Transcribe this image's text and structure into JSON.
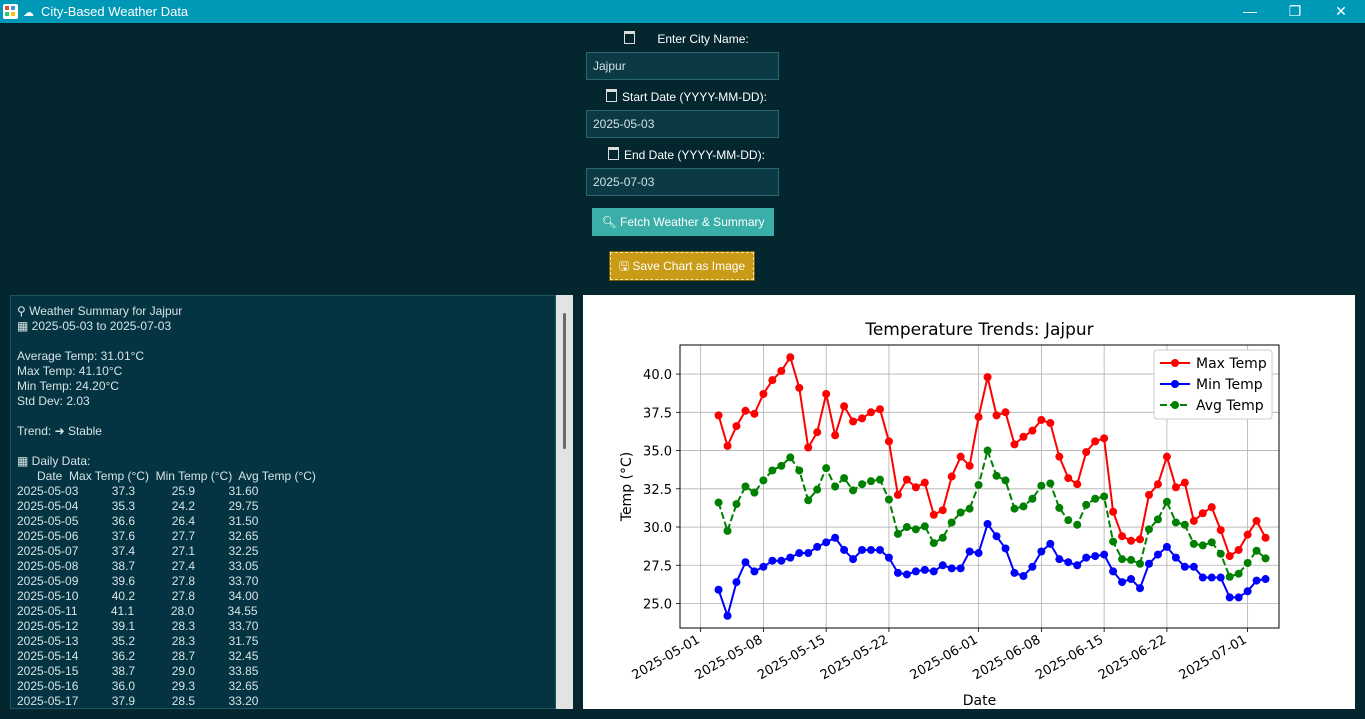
{
  "window": {
    "title": "City-Based Weather Data",
    "controls": {
      "minimize": "—",
      "restore": "❐",
      "close": "✕"
    }
  },
  "form": {
    "city_label": "Enter City Name:",
    "city_value": "Jajpur",
    "start_label": "Start Date (YYYY-MM-DD):",
    "start_value": "2025-05-03",
    "end_label": "End Date (YYYY-MM-DD):",
    "end_value": "2025-07-03",
    "fetch_button": "Fetch Weather & Summary",
    "save_button": "Save Chart as Image"
  },
  "summary": {
    "text": "⚲ Weather Summary for Jajpur\n▦ 2025-05-03 to 2025-07-03\n\nAverage Temp: 31.01°C\nMax Temp: 41.10°C\nMin Temp: 24.20°C\nStd Dev: 2.03\n\nTrend: ➜ Stable\n\n▦ Daily Data:\n      Date  Max Temp (°C)  Min Temp (°C)  Avg Temp (°C)\n2025-05-03          37.3           25.9          31.60\n2025-05-04          35.3           24.2          29.75\n2025-05-05          36.6           26.4          31.50\n2025-05-06          37.6           27.7          32.65\n2025-05-07          37.4           27.1          32.25\n2025-05-08          38.7           27.4          33.05\n2025-05-09          39.6           27.8          33.70\n2025-05-10          40.2           27.8          34.00\n2025-05-11          41.1           28.0          34.55\n2025-05-12          39.1           28.3          33.70\n2025-05-13          35.2           28.3          31.75\n2025-05-14          36.2           28.7          32.45\n2025-05-15          38.7           29.0          33.85\n2025-05-16          36.0           29.3          32.65\n2025-05-17          37.9           28.5          33.20"
  },
  "colors": {
    "max": "#ff0000",
    "min": "#0000ff",
    "avg": "#008000",
    "accent": "#0098b7"
  },
  "chart_data": {
    "type": "line",
    "title": "Temperature Trends: Jajpur",
    "xlabel": "Date",
    "ylabel": "Temp (°C)",
    "ylim": [
      23.4,
      41.9
    ],
    "yticks": [
      "25.0",
      "27.5",
      "30.0",
      "32.5",
      "35.0",
      "37.5",
      "40.0"
    ],
    "xticks": [
      "2025-05-01",
      "2025-05-08",
      "2025-05-15",
      "2025-05-22",
      "2025-06-01",
      "2025-06-08",
      "2025-06-15",
      "2025-06-22",
      "2025-07-01"
    ],
    "grid": true,
    "legend_position": "top-right",
    "x": [
      "2025-05-03",
      "2025-05-04",
      "2025-05-05",
      "2025-05-06",
      "2025-05-07",
      "2025-05-08",
      "2025-05-09",
      "2025-05-10",
      "2025-05-11",
      "2025-05-12",
      "2025-05-13",
      "2025-05-14",
      "2025-05-15",
      "2025-05-16",
      "2025-05-17",
      "2025-05-18",
      "2025-05-19",
      "2025-05-20",
      "2025-05-21",
      "2025-05-22",
      "2025-05-23",
      "2025-05-24",
      "2025-05-25",
      "2025-05-26",
      "2025-05-27",
      "2025-05-28",
      "2025-05-29",
      "2025-05-30",
      "2025-05-31",
      "2025-06-01",
      "2025-06-02",
      "2025-06-03",
      "2025-06-04",
      "2025-06-05",
      "2025-06-06",
      "2025-06-07",
      "2025-06-08",
      "2025-06-09",
      "2025-06-10",
      "2025-06-11",
      "2025-06-12",
      "2025-06-13",
      "2025-06-14",
      "2025-06-15",
      "2025-06-16",
      "2025-06-17",
      "2025-06-18",
      "2025-06-19",
      "2025-06-20",
      "2025-06-21",
      "2025-06-22",
      "2025-06-23",
      "2025-06-24",
      "2025-06-25",
      "2025-06-26",
      "2025-06-27",
      "2025-06-28",
      "2025-06-29",
      "2025-06-30",
      "2025-07-01",
      "2025-07-02",
      "2025-07-03"
    ],
    "series": [
      {
        "name": "Max Temp",
        "values": [
          37.3,
          35.3,
          36.6,
          37.6,
          37.4,
          38.7,
          39.6,
          40.2,
          41.1,
          39.1,
          35.2,
          36.2,
          38.7,
          36.0,
          37.9,
          36.9,
          37.1,
          37.5,
          37.7,
          35.6,
          32.1,
          33.1,
          32.6,
          32.9,
          30.8,
          31.1,
          33.3,
          34.6,
          34.0,
          37.2,
          39.8,
          37.3,
          37.5,
          35.4,
          35.9,
          36.3,
          37.0,
          36.8,
          34.6,
          33.2,
          32.8,
          34.9,
          35.6,
          35.8,
          31.0,
          29.4,
          29.1,
          29.2,
          32.1,
          32.8,
          34.6,
          32.6,
          32.9,
          30.4,
          30.9,
          31.3,
          29.8,
          28.1,
          28.5,
          29.5,
          30.4,
          29.3
        ]
      },
      {
        "name": "Min Temp",
        "values": [
          25.9,
          24.2,
          26.4,
          27.7,
          27.1,
          27.4,
          27.8,
          27.8,
          28.0,
          28.3,
          28.3,
          28.7,
          29.0,
          29.3,
          28.5,
          27.9,
          28.5,
          28.5,
          28.5,
          28.0,
          27.0,
          26.9,
          27.1,
          27.2,
          27.1,
          27.5,
          27.3,
          27.3,
          28.4,
          28.3,
          30.2,
          29.4,
          28.6,
          27.0,
          26.8,
          27.4,
          28.4,
          28.9,
          27.9,
          27.7,
          27.5,
          28.0,
          28.1,
          28.2,
          27.1,
          26.4,
          26.6,
          26.0,
          27.6,
          28.2,
          28.7,
          28.0,
          27.4,
          27.4,
          26.7,
          26.7,
          26.7,
          25.4,
          25.4,
          25.8,
          26.5,
          26.6
        ]
      },
      {
        "name": "Avg Temp",
        "values": [
          31.6,
          29.75,
          31.5,
          32.65,
          32.25,
          33.05,
          33.7,
          34.0,
          34.55,
          33.7,
          31.75,
          32.45,
          33.85,
          32.65,
          33.2,
          32.4,
          32.8,
          33.0,
          33.1,
          31.8,
          29.55,
          30.0,
          29.85,
          30.05,
          28.95,
          29.3,
          30.3,
          30.95,
          31.2,
          32.75,
          35.0,
          33.35,
          33.05,
          31.2,
          31.35,
          31.85,
          32.7,
          32.85,
          31.25,
          30.45,
          30.15,
          31.45,
          31.85,
          32.0,
          29.05,
          27.9,
          27.85,
          27.6,
          29.85,
          30.5,
          31.65,
          30.3,
          30.15,
          28.9,
          28.8,
          29.0,
          28.25,
          26.75,
          26.95,
          27.65,
          28.45,
          27.95
        ]
      }
    ]
  }
}
